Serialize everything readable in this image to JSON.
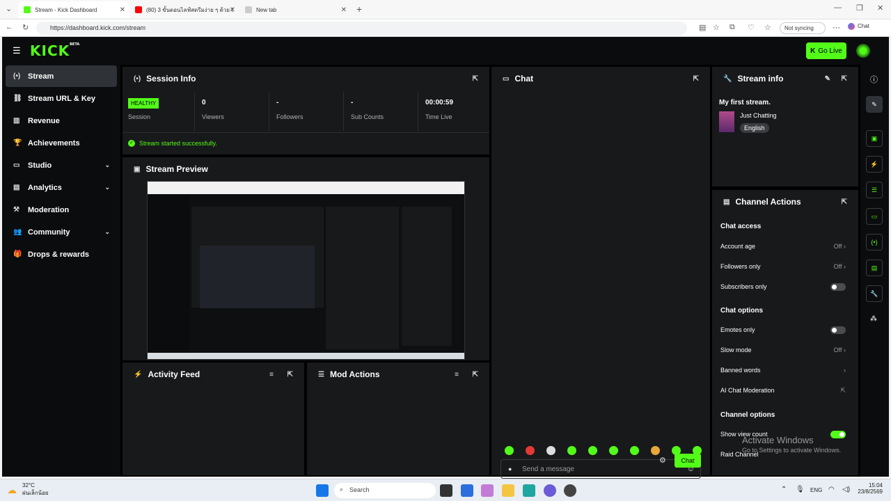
{
  "browser": {
    "tabs": [
      {
        "label": "Stream - Kick Dashboard",
        "fav": "#53fc18"
      },
      {
        "label": "(80) 3 ขั้นตอนไลฟ์สตรีมง่าย ๆ ด้วย OBS",
        "fav": "#ff0000"
      },
      {
        "label": "New tab",
        "fav": "#cccccc"
      }
    ],
    "url": "https://dashboard.kick.com/stream",
    "profile": "Not syncing",
    "chat_button": "Chat"
  },
  "app": {
    "logo": "KICK",
    "logo_badge": "BETA",
    "go_live": "Go Live",
    "colors": {
      "accent": "#53fc18",
      "bg": "#000000",
      "panel": "#18191b"
    }
  },
  "sidebar": {
    "items": [
      {
        "label": "Stream",
        "icon": "broadcast-icon",
        "active": true
      },
      {
        "label": "Stream URL & Key",
        "icon": "link-icon"
      },
      {
        "label": "Revenue",
        "icon": "chart-icon"
      },
      {
        "label": "Achievements",
        "icon": "trophy-icon"
      },
      {
        "label": "Studio",
        "icon": "video-icon",
        "chevron": true
      },
      {
        "label": "Analytics",
        "icon": "analytics-icon",
        "chevron": true
      },
      {
        "label": "Moderation",
        "icon": "hammer-icon"
      },
      {
        "label": "Community",
        "icon": "users-icon",
        "chevron": true
      },
      {
        "label": "Drops & rewards",
        "icon": "gift-icon"
      }
    ]
  },
  "session": {
    "title": "Session Info",
    "badge": "HEALTHY",
    "session_label": "Session",
    "stats": [
      {
        "value": "0",
        "label": "Viewers"
      },
      {
        "value": "-",
        "label": "Followers"
      },
      {
        "value": "-",
        "label": "Sub Counts"
      },
      {
        "value": "00:00:59",
        "label": "Time Live"
      }
    ],
    "message": "Stream started successfully."
  },
  "preview": {
    "title": "Stream Preview"
  },
  "activity": {
    "title": "Activity Feed"
  },
  "mod": {
    "title": "Mod Actions"
  },
  "chat": {
    "title": "Chat",
    "placeholder": "Send a message",
    "send": "Chat"
  },
  "stream_info": {
    "title": "Stream info",
    "stream_title": "My first stream.",
    "category": "Just Chatting",
    "language": "English"
  },
  "channel_actions": {
    "title": "Channel Actions",
    "chat_access": "Chat access",
    "account_age": "Account age",
    "account_age_val": "Off",
    "followers_only": "Followers only",
    "followers_only_val": "Off",
    "subscribers_only": "Subscribers only",
    "chat_options": "Chat options",
    "emotes_only": "Emotes only",
    "slow_mode": "Slow mode",
    "slow_mode_val": "Off",
    "banned_words": "Banned words",
    "ai_moderation": "AI Chat Moderation",
    "channel_options": "Channel options",
    "show_view_count": "Show view count",
    "raid_channel": "Raid Channel"
  },
  "watermark": {
    "line1": "Activate Windows",
    "line2": "Go to Settings to activate Windows."
  },
  "taskbar": {
    "weather_temp": "32°C",
    "weather_desc": "ฝนเล็กน้อย",
    "search": "Search",
    "lang": "ENG",
    "time": "15:04",
    "date": "23/8/2569"
  }
}
